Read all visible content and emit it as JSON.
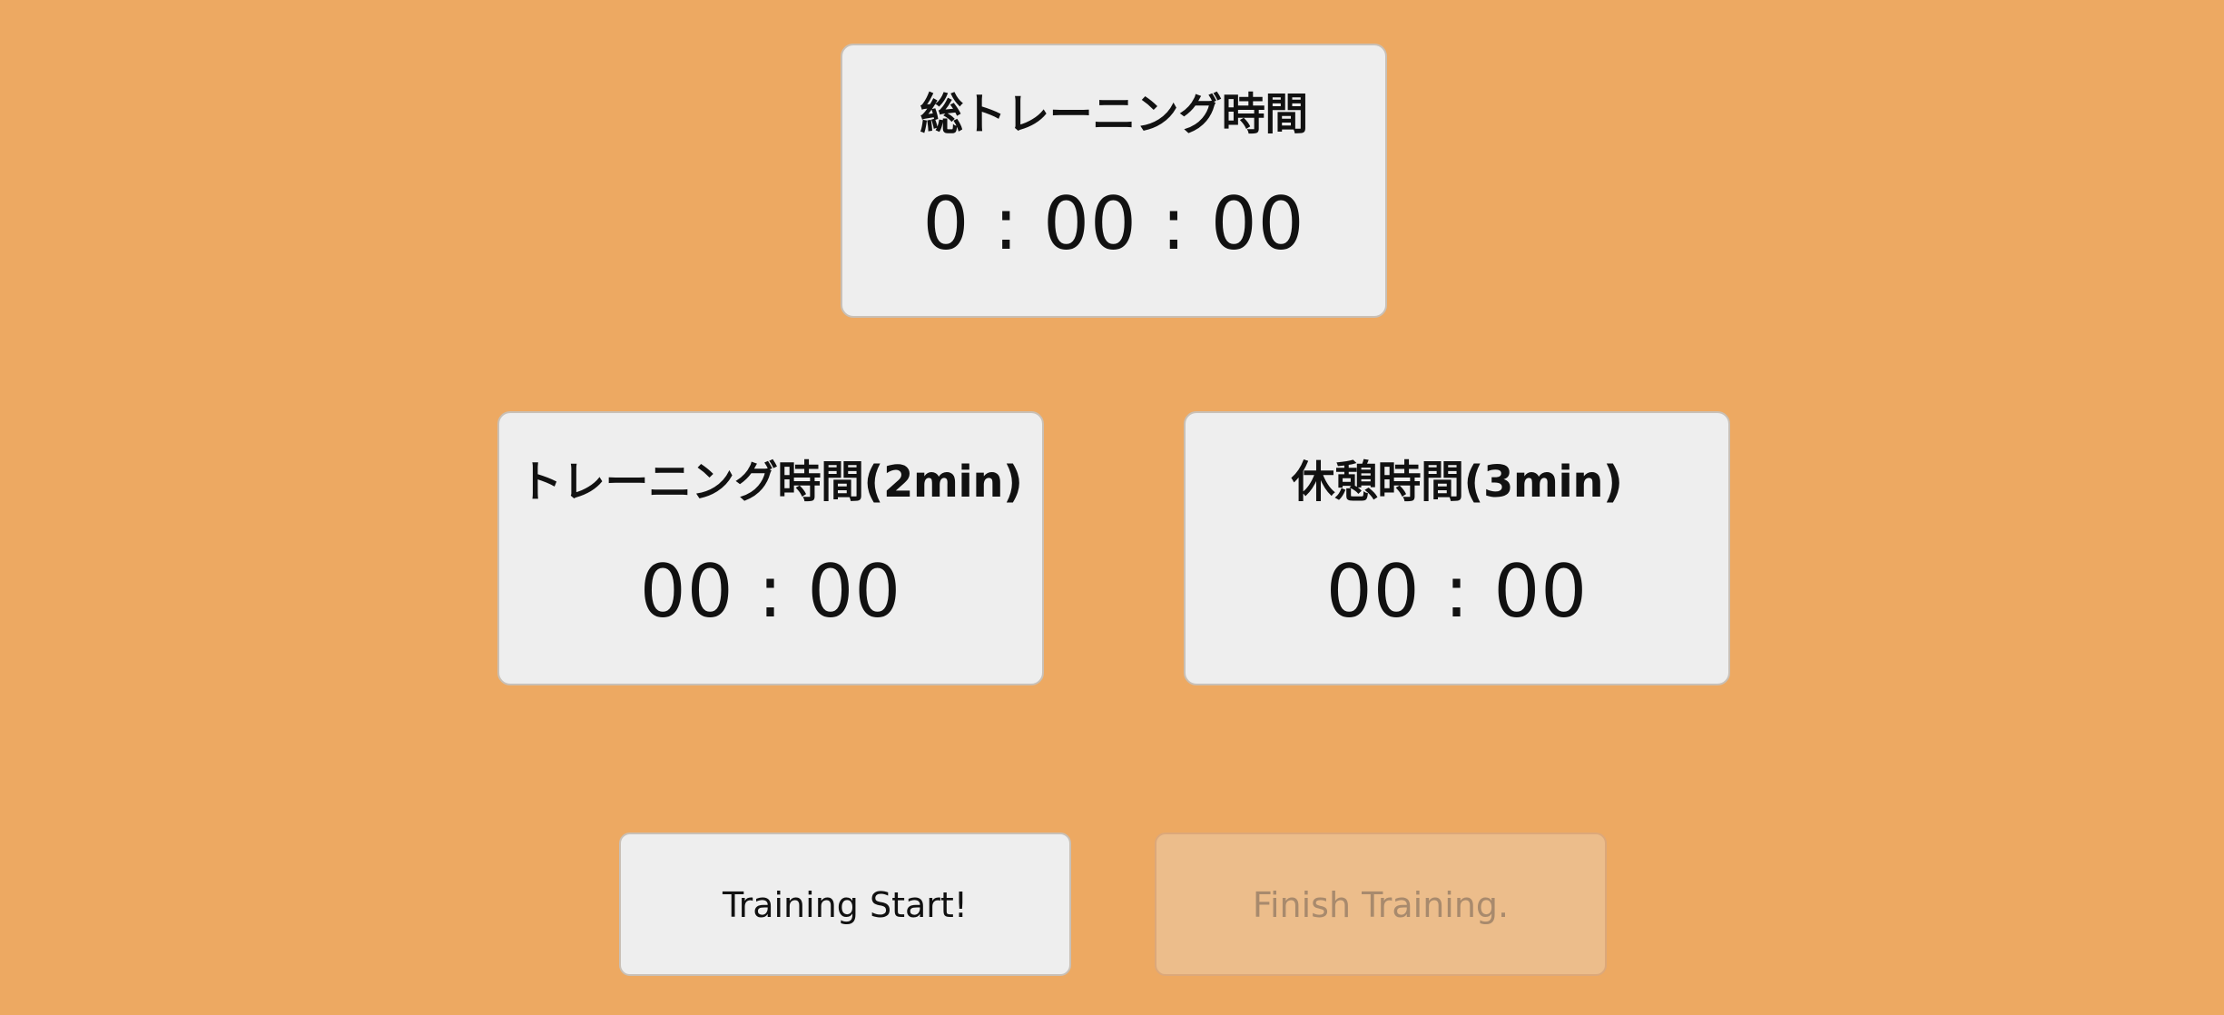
{
  "total_timer": {
    "title": "総トレーニング時間",
    "time": "0 : 00 : 00"
  },
  "training_timer": {
    "title": "トレーニング時間(2min)",
    "time": "00 : 00"
  },
  "rest_timer": {
    "title": "休憩時間(3min)",
    "time": "00 : 00"
  },
  "buttons": {
    "start_label": "Training Start!",
    "finish_label": "Finish Training.",
    "finish_disabled": true
  },
  "colors": {
    "background": "#eda962",
    "card": "#eeeeee",
    "text": "#111111",
    "disabled_button": "#ecbd8b",
    "disabled_text": "#a88a6d"
  }
}
